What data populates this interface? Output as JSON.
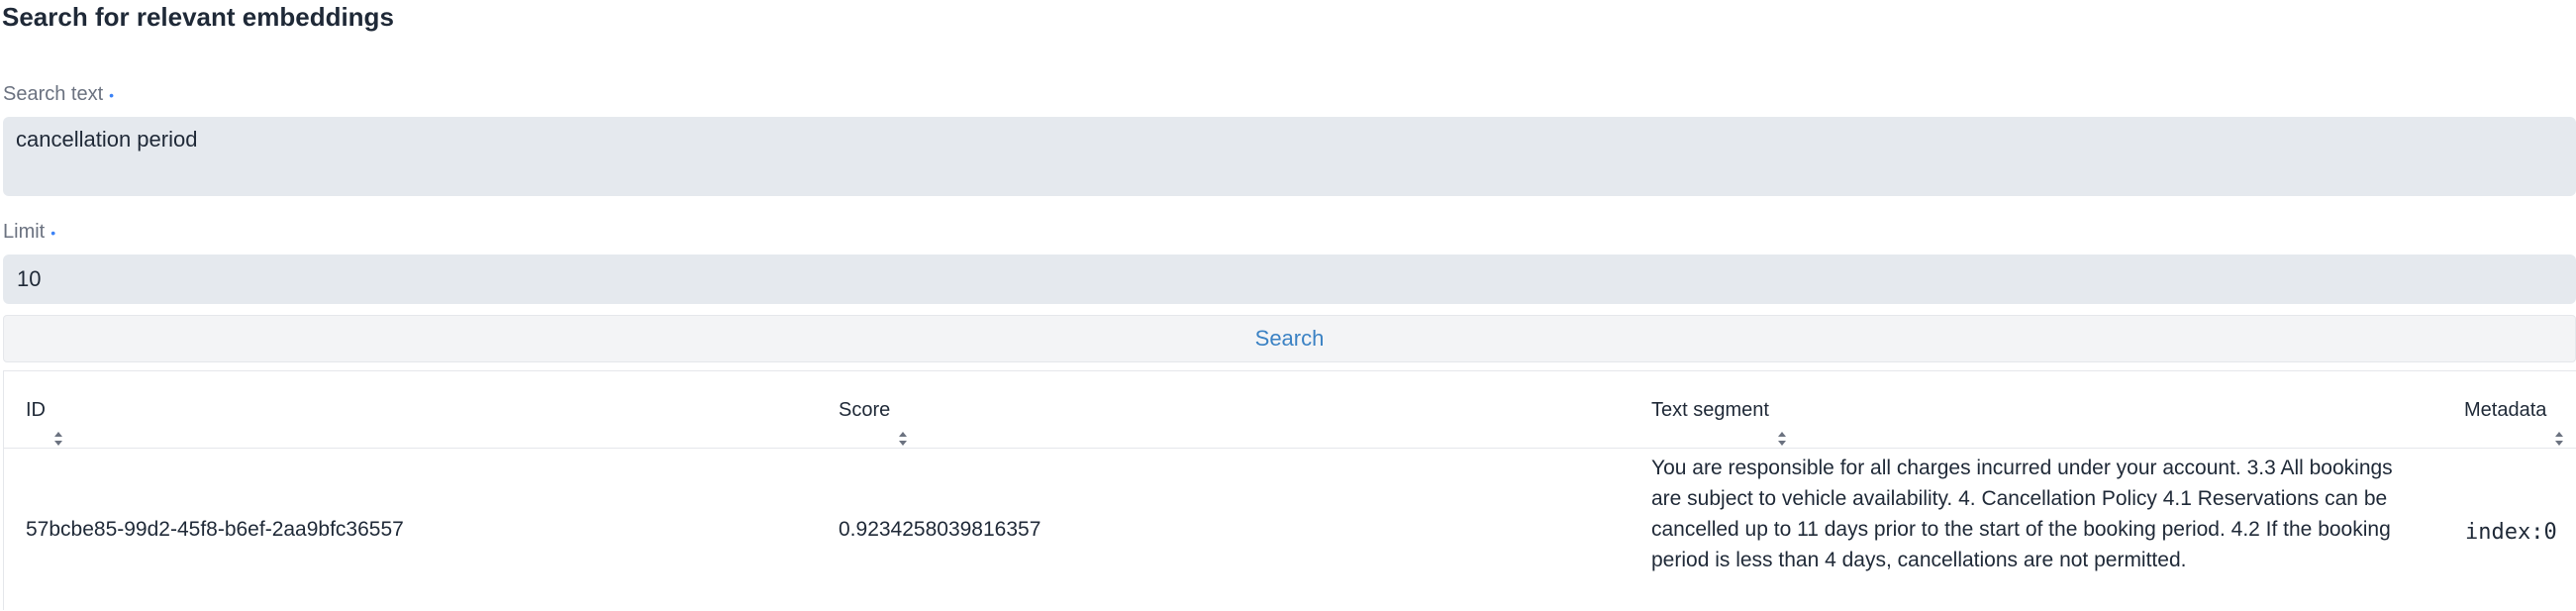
{
  "heading": "Search for relevant embeddings",
  "form": {
    "search_text": {
      "label": "Search text",
      "required_mark": "•",
      "value": "cancellation period"
    },
    "limit": {
      "label": "Limit",
      "required_mark": "•",
      "value": "10"
    },
    "search_button_label": "Search"
  },
  "table": {
    "columns": [
      "ID",
      "Score",
      "Text segment",
      "Metadata"
    ],
    "rows": [
      {
        "id": "57bcbe85-99d2-45f8-b6ef-2aa9bfc36557",
        "score": "0.9234258039816357",
        "text_segment": "You are responsible for all charges incurred under your account. 3.3 All bookings are subject to vehicle availability. 4. Cancellation Policy 4.1 Reservations can be cancelled up to 11 days prior to the start of the booking period. 4.2 If the booking period is less than 4 days, cancellations are not permitted.",
        "metadata": "index:0"
      }
    ]
  },
  "icons": {
    "sort": "sort-icon"
  },
  "colors": {
    "accent": "#3b82c4",
    "required_mark": "#3b82f6",
    "field_bg": "#e5e9ee",
    "button_bg": "#f3f4f6"
  }
}
